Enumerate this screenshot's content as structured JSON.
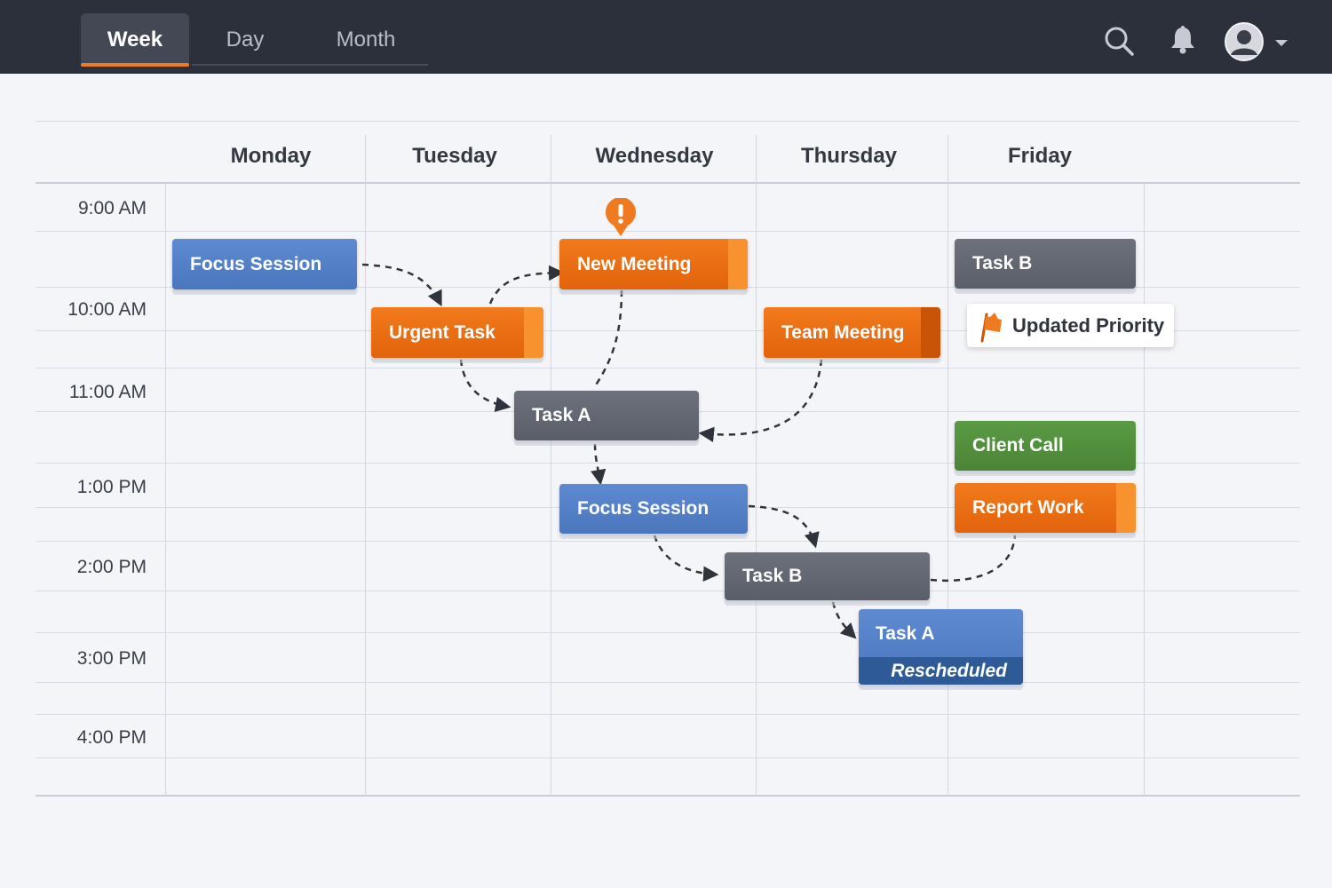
{
  "topbar": {
    "tabs": [
      {
        "label": "Week",
        "active": true
      },
      {
        "label": "Day",
        "active": false
      },
      {
        "label": "Month",
        "active": false
      }
    ],
    "icons": [
      "search-icon",
      "bell-icon",
      "avatar-icon",
      "chevron-down-icon"
    ]
  },
  "calendar": {
    "days": [
      "Monday",
      "Tuesday",
      "Wednesday",
      "Thursday",
      "Friday"
    ],
    "times": [
      "9:00 AM",
      "10:00 AM",
      "11:00 AM",
      "1:00 PM",
      "2:00 PM",
      "3:00 PM",
      "4:00 PM"
    ]
  },
  "events": {
    "mon_focus": "Focus Session",
    "tue_urgent": "Urgent Task",
    "wed_new_meeting": "New Meeting",
    "wed_task_a": "Task A",
    "wed_focus": "Focus Session",
    "thu_team_meeting": "Team Meeting",
    "thu_task_b": "Task B",
    "thu_task_a": "Task A",
    "thu_task_a_sub": "Rescheduled",
    "fri_task_b": "Task B",
    "fri_client_call": "Client Call",
    "fri_report_work": "Report Work",
    "priority_tag": "Updated Priority"
  },
  "colors": {
    "topbar": "#2c303a",
    "accent_orange": "#ef7a1f",
    "event_blue": "#4a76bd",
    "event_gray": "#5f636d",
    "event_green": "#4e8a3a"
  }
}
